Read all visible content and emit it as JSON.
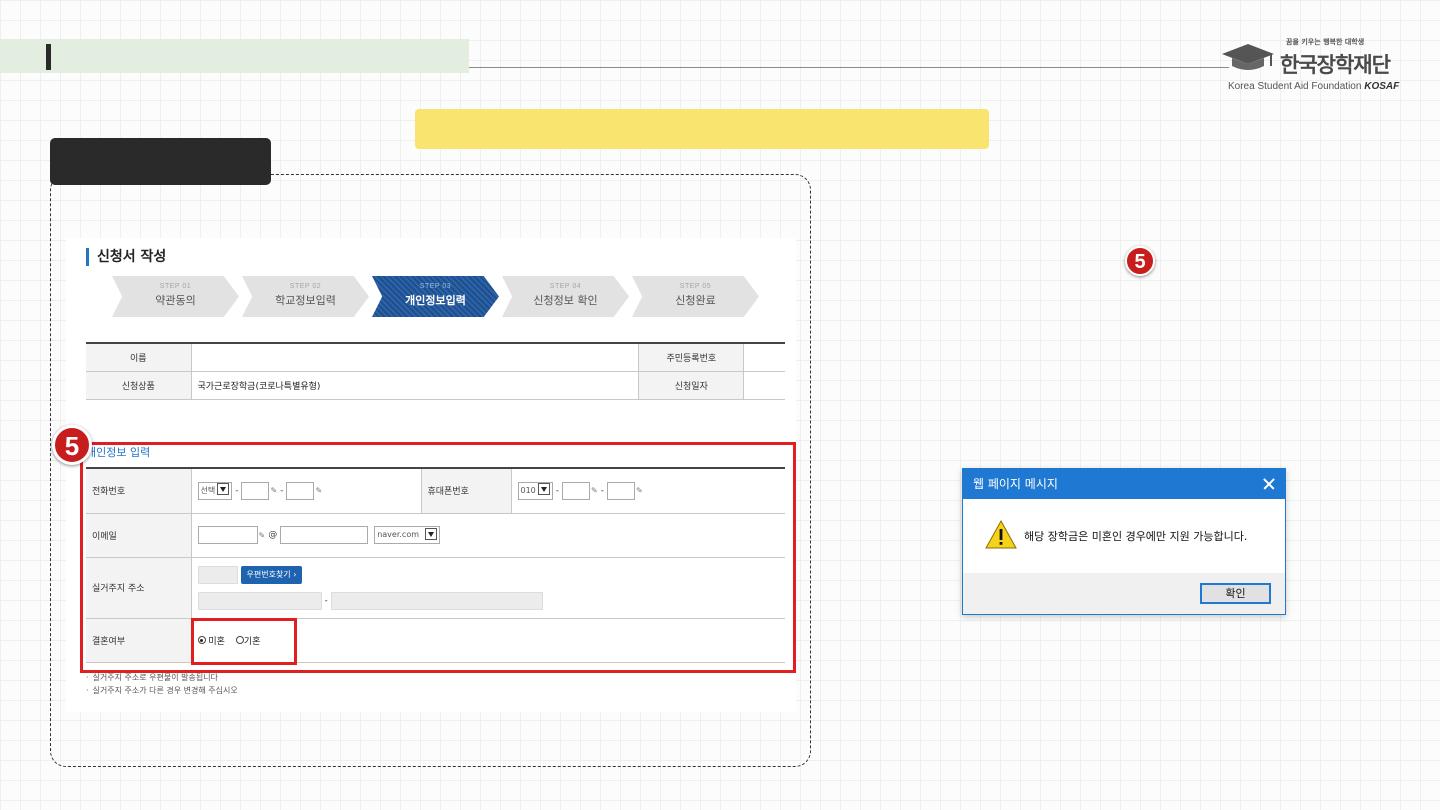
{
  "logo": {
    "small_text": "꿈을 키우는 행복한 대학생",
    "main_text": "한국장학재단",
    "sub_text": "Korea Student Aid Foundation",
    "sub_brand": "KOSAF"
  },
  "form": {
    "title": "신청서 작성",
    "steps": [
      {
        "num": "STEP 01",
        "label": "약관동의"
      },
      {
        "num": "STEP 02",
        "label": "학교정보입력"
      },
      {
        "num": "STEP 03",
        "label": "개인정보입력"
      },
      {
        "num": "STEP 04",
        "label": "신청정보 확인"
      },
      {
        "num": "STEP 05",
        "label": "신청완료"
      }
    ],
    "info": {
      "name_label": "이름",
      "rrn_label": "주민등록번호",
      "product_label": "신청상품",
      "product_value": "국가근로장학금(코로나특별유형)",
      "date_label": "신청일자"
    },
    "personal": {
      "section_title": "개인정보 입력",
      "phone_label": "전화번호",
      "phone_select": "선택",
      "mobile_label": "휴대폰번호",
      "mobile_select": "010",
      "email_label": "이메일",
      "email_at": "@",
      "email_domain": "naver.com",
      "address_label": "실거주지 주소",
      "zip_button": "우편번호찾기",
      "marital_label": "결혼여부",
      "marital_single": "미혼",
      "marital_married": "기혼"
    },
    "notes": [
      "실거주지 주소로 우편물이 발송됩니다",
      "실거주지 주소가 다른 경우 변경해 주십시오"
    ]
  },
  "annotation": {
    "badge_main": "5",
    "badge_side": "5"
  },
  "dialog": {
    "title": "웹 페이지 메시지",
    "message": "해당 장학금은 미혼인 경우에만 지원 가능합니다.",
    "ok_label": "확인"
  },
  "colors": {
    "accent_blue": "#1f78d1",
    "highlight_red": "#e02020",
    "yellow_bar": "#fae470",
    "header_band": "#e3ede0",
    "active_step": "#2c63a8"
  }
}
